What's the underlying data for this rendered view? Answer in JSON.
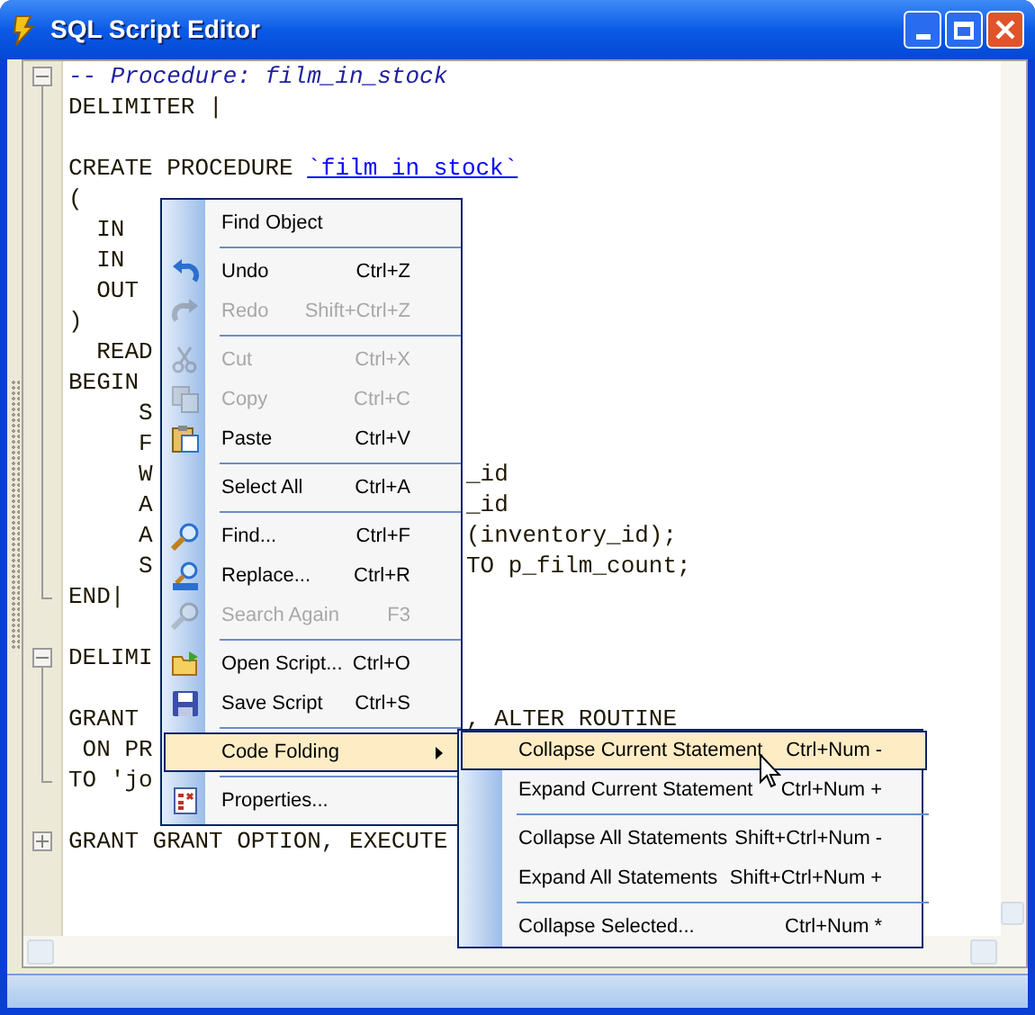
{
  "window": {
    "title": "SQL Script Editor"
  },
  "editor": {
    "lines": [
      {
        "kind": "fold_start",
        "expanded": true,
        "segments": [
          {
            "text": "-- Procedure: film_in_stock",
            "kind": "comment"
          }
        ]
      },
      {
        "kind": "line",
        "segments": [
          {
            "text": "DELIMITER |",
            "kind": "code"
          }
        ]
      },
      {
        "kind": "line"
      },
      {
        "kind": "line",
        "segments": [
          {
            "text": "CREATE PROCEDURE ",
            "kind": "code"
          },
          {
            "text": "`film in stock`",
            "kind": "identifier"
          }
        ]
      },
      {
        "kind": "line",
        "segments": [
          {
            "text": "(",
            "kind": "code"
          }
        ]
      },
      {
        "kind": "line",
        "segments": [
          {
            "text": "  IN",
            "kind": "code"
          }
        ]
      },
      {
        "kind": "line",
        "segments": [
          {
            "text": "  IN",
            "kind": "code"
          }
        ]
      },
      {
        "kind": "line",
        "segments": [
          {
            "text": "  OUT",
            "kind": "code"
          }
        ]
      },
      {
        "kind": "line",
        "segments": [
          {
            "text": ")",
            "kind": "code"
          }
        ]
      },
      {
        "kind": "line",
        "segments": [
          {
            "text": "  READ",
            "kind": "code"
          }
        ]
      },
      {
        "kind": "line",
        "segments": [
          {
            "text": "BEGIN",
            "kind": "code"
          }
        ]
      },
      {
        "kind": "line",
        "segments": [
          {
            "text": "     S",
            "kind": "code"
          }
        ]
      },
      {
        "kind": "line",
        "segments": [
          {
            "text": "     F",
            "kind": "code"
          }
        ]
      },
      {
        "kind": "line",
        "segments": [
          {
            "text": "     W",
            "kind": "code"
          }
        ],
        "right": "_id"
      },
      {
        "kind": "line",
        "segments": [
          {
            "text": "     A",
            "kind": "code"
          }
        ],
        "right": "_id"
      },
      {
        "kind": "line",
        "segments": [
          {
            "text": "     A",
            "kind": "code"
          }
        ],
        "right": "(inventory_id);"
      },
      {
        "kind": "line",
        "segments": [
          {
            "text": "     S",
            "kind": "code"
          }
        ],
        "right": "TO p_film_count;"
      },
      {
        "kind": "fold_end",
        "segments": [
          {
            "text": "END|",
            "kind": "code"
          }
        ]
      },
      {
        "kind": "line"
      },
      {
        "kind": "fold_start",
        "expanded": true,
        "segments": [
          {
            "text": "DELIMI",
            "kind": "code"
          }
        ]
      },
      {
        "kind": "line"
      },
      {
        "kind": "line",
        "segments": [
          {
            "text": "GRANT",
            "kind": "code"
          }
        ],
        "right": ", ALTER ROUTINE"
      },
      {
        "kind": "line",
        "segments": [
          {
            "text": " ON PR",
            "kind": "code"
          }
        ]
      },
      {
        "kind": "fold_end",
        "segments": [
          {
            "text": "TO 'jo",
            "kind": "code"
          }
        ]
      },
      {
        "kind": "line"
      },
      {
        "kind": "fold_start",
        "expanded": false,
        "segments": [
          {
            "text": "GRANT GRANT OPTION, EXECUTE",
            "kind": "code"
          }
        ]
      }
    ]
  },
  "context_menu": {
    "items": [
      {
        "kind": "item",
        "label": "Find Object",
        "disabled": false,
        "selected": false
      },
      {
        "kind": "separator"
      },
      {
        "kind": "item",
        "label": "Undo",
        "shortcut": "Ctrl+Z",
        "disabled": false,
        "selected": false
      },
      {
        "kind": "item",
        "label": "Redo",
        "shortcut": "Shift+Ctrl+Z",
        "disabled": true,
        "selected": false
      },
      {
        "kind": "separator"
      },
      {
        "kind": "item",
        "label": "Cut",
        "shortcut": "Ctrl+X",
        "disabled": true,
        "selected": false
      },
      {
        "kind": "item",
        "label": "Copy",
        "shortcut": "Ctrl+C",
        "disabled": true,
        "selected": false
      },
      {
        "kind": "item",
        "label": "Paste",
        "shortcut": "Ctrl+V",
        "disabled": false,
        "selected": false
      },
      {
        "kind": "separator"
      },
      {
        "kind": "item",
        "label": "Select All",
        "shortcut": "Ctrl+A",
        "disabled": false,
        "selected": false
      },
      {
        "kind": "separator"
      },
      {
        "kind": "item",
        "label": "Find...",
        "shortcut": "Ctrl+F",
        "disabled": false,
        "selected": false
      },
      {
        "kind": "item",
        "label": "Replace...",
        "shortcut": "Ctrl+R",
        "disabled": false,
        "selected": false
      },
      {
        "kind": "item",
        "label": "Search Again",
        "shortcut": "F3",
        "disabled": true,
        "selected": false
      },
      {
        "kind": "separator"
      },
      {
        "kind": "item",
        "label": "Open Script...",
        "shortcut": "Ctrl+O",
        "disabled": false,
        "selected": false
      },
      {
        "kind": "item",
        "label": "Save Script",
        "shortcut": "Ctrl+S",
        "disabled": false,
        "selected": false
      },
      {
        "kind": "separator"
      },
      {
        "kind": "submenu",
        "label": "Code Folding",
        "disabled": false,
        "selected": true
      },
      {
        "kind": "separator"
      },
      {
        "kind": "item",
        "label": "Properties...",
        "disabled": false,
        "selected": false
      }
    ]
  },
  "submenu": {
    "items": [
      {
        "kind": "item",
        "label": "Collapse Current Statement",
        "shortcut": "Ctrl+Num -",
        "selected": true
      },
      {
        "kind": "item",
        "label": "Expand Current Statement",
        "shortcut": "Ctrl+Num +",
        "selected": false
      },
      {
        "kind": "separator"
      },
      {
        "kind": "item",
        "label": "Collapse All Statements",
        "shortcut": "Shift+Ctrl+Num -",
        "selected": false
      },
      {
        "kind": "item",
        "label": "Expand All Statements",
        "shortcut": "Shift+Ctrl+Num +",
        "selected": false
      },
      {
        "kind": "separator"
      },
      {
        "kind": "item",
        "label": "Collapse Selected...",
        "shortcut": "Ctrl+Num *",
        "selected": false
      }
    ]
  }
}
